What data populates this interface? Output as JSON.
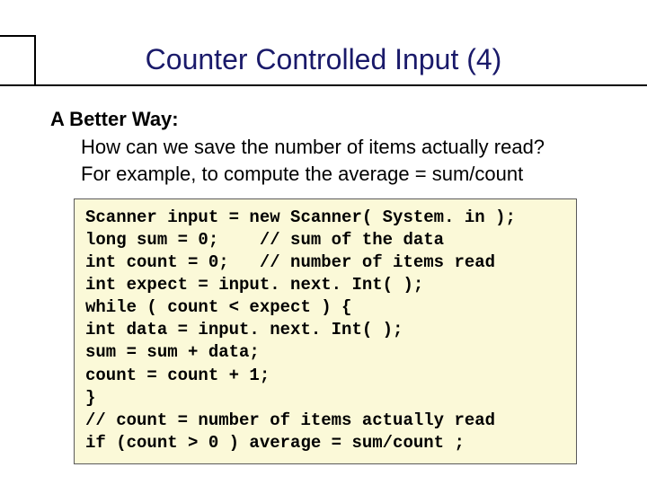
{
  "title": "Counter Controlled Input (4)",
  "lead": "A Better Way:",
  "para1": "How can we save the number of items actually read?",
  "para2": "For example, to compute the average = sum/count",
  "code": {
    "l1": "Scanner input = new Scanner( System. in );",
    "l2": "long sum = 0;    // sum of the data",
    "l3": "int count = 0;   // number of items read",
    "l4": "int expect = input. next. Int( );",
    "l5": "while ( count < expect ) {",
    "l6": "int data = input. next. Int( );",
    "l7": "sum = sum + data;",
    "l8": "count = count + 1;",
    "l9": "}",
    "l10": "// count = number of items actually read",
    "l11": "if (count > 0 ) average = sum/count ;"
  }
}
